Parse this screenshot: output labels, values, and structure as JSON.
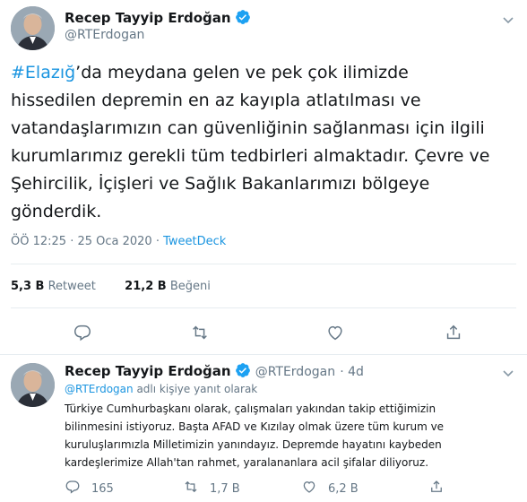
{
  "main_tweet": {
    "author_name": "Recep Tayyip Erdoğan",
    "handle": "@RTErdogan",
    "hashtag": "#Elazığ",
    "text_lines": [
      "’da meydana gelen ve pek çok ilimizde",
      "hissedilen depremin en az kayıpla atlatılması ve",
      "vatandaşlarımızın can güvenliğinin sağlanması için ilgili",
      "kurumlarımız gerekli tüm tedbirleri almaktadır. Çevre ve",
      "Şehircilik, İçişleri ve Sağlık Bakanlarımızı bölgeye",
      "gönderdik."
    ],
    "timestamp": "ÖÖ 12:25 · 25 Oca 2020 · ",
    "source": "TweetDeck",
    "retweet_count": "5,3 B",
    "retweet_label": "Retweet",
    "like_count": "21,2 B",
    "like_label": "Beğeni"
  },
  "reply_tweet": {
    "author_name": "Recep Tayyip Erdoğan",
    "handle": "@RTErdogan",
    "time": "· 4d",
    "reply_handle": "@RTErdogan",
    "reply_suffix": " adlı kişiye yanıt olarak",
    "text_lines": [
      "Türkiye Cumhurbaşkanı olarak, çalışmaları yakından takip ettiğimizin",
      "bilinmesini istiyoruz. Başta AFAD ve Kızılay olmak üzere tüm kurum ve",
      "kuruluşlarımızla Milletimizin yanındayız. Depremde hayatını kaybeden",
      "kardeşlerimize Allah'tan rahmet, yaralananlara acil şifalar diliyoruz."
    ],
    "reply_count": "165",
    "retweet_count": "1,7 B",
    "like_count": "6,2 B"
  },
  "colors": {
    "link": "#1b95e0",
    "muted": "#657786",
    "verified": "#1da1f2",
    "divider": "#e6ecf0"
  },
  "icons": [
    "chevron-down-icon",
    "verified-badge-icon",
    "reply-icon",
    "retweet-icon",
    "like-icon",
    "share-icon"
  ]
}
